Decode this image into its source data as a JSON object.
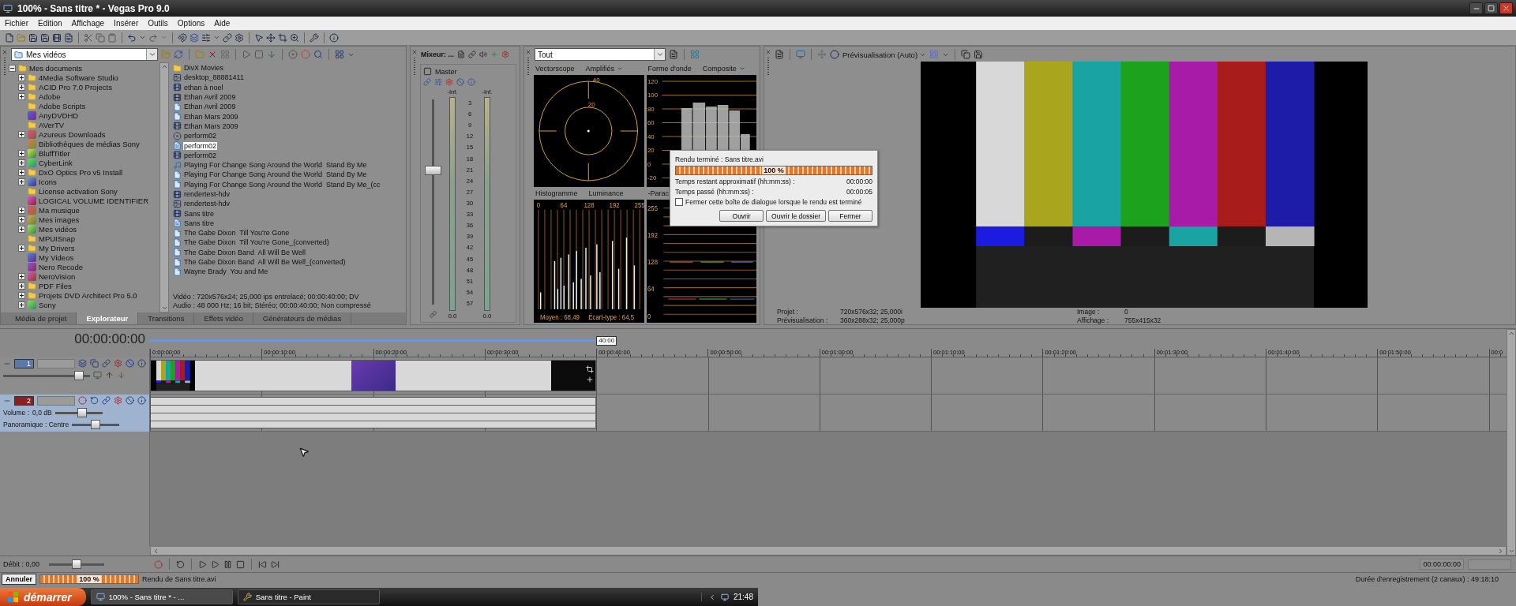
{
  "window": {
    "title": "100% - Sans titre * - Vegas Pro 9.0"
  },
  "menu": [
    "Fichier",
    "Edition",
    "Affichage",
    "Insérer",
    "Outils",
    "Options",
    "Aide"
  ],
  "explorer": {
    "location": "Mes vidéos",
    "tree": {
      "label": "Mes documents",
      "kind": "folder",
      "expanded": true,
      "children": [
        {
          "label": "4Media Software Studio",
          "kind": "folder",
          "expandable": true
        },
        {
          "label": "ACID Pro 7.0 Projects",
          "kind": "folder",
          "expandable": true
        },
        {
          "label": "Adobe",
          "kind": "folder",
          "expandable": true
        },
        {
          "label": "Adobe Scripts",
          "kind": "folder",
          "expandable": false
        },
        {
          "label": "AnyDVDHD",
          "kind": "app",
          "expandable": false
        },
        {
          "label": "AVerTV",
          "kind": "folder",
          "expandable": false
        },
        {
          "label": "Azureus Downloads",
          "kind": "app",
          "expandable": true
        },
        {
          "label": "Bibliothèques de médias Sony",
          "kind": "app",
          "expandable": false
        },
        {
          "label": "BluffTitler",
          "kind": "app",
          "expandable": true
        },
        {
          "label": "CyberLink",
          "kind": "app",
          "expandable": true
        },
        {
          "label": "DxO Optics Pro v5 Install",
          "kind": "folder",
          "expandable": true
        },
        {
          "label": "Icons",
          "kind": "app",
          "expandable": true
        },
        {
          "label": "License activation Sony",
          "kind": "folder",
          "expandable": false
        },
        {
          "label": "LOGICAL VOLUME IDENTIFIER",
          "kind": "app",
          "expandable": false
        },
        {
          "label": "Ma musique",
          "kind": "app",
          "expandable": true
        },
        {
          "label": "Mes images",
          "kind": "app",
          "expandable": true
        },
        {
          "label": "Mes vidéos",
          "kind": "app",
          "expandable": true
        },
        {
          "label": "MPUISnap",
          "kind": "folder",
          "expandable": false
        },
        {
          "label": "My Drivers",
          "kind": "folder",
          "expandable": true
        },
        {
          "label": "My Videos",
          "kind": "app",
          "expandable": false
        },
        {
          "label": "Nero Recode",
          "kind": "app",
          "expandable": false
        },
        {
          "label": "NeroVision",
          "kind": "app",
          "expandable": true
        },
        {
          "label": "PDF Files",
          "kind": "folder",
          "expandable": true
        },
        {
          "label": "Projets DVD Architect Pro 5.0",
          "kind": "folder",
          "expandable": true
        },
        {
          "label": "Sony",
          "kind": "app",
          "expandable": true
        }
      ]
    },
    "files": [
      {
        "name": "DivX Movies",
        "kind": "folder",
        "selected": false
      },
      {
        "name": "desktop_88881411",
        "kind": "image",
        "selected": false
      },
      {
        "name": "ethan à noel",
        "kind": "video",
        "selected": false
      },
      {
        "name": "Ethan Avril 2009",
        "kind": "video",
        "selected": false
      },
      {
        "name": "Ethan Avril 2009",
        "kind": "media",
        "selected": false
      },
      {
        "name": "Ethan Mars 2009",
        "kind": "media",
        "selected": false
      },
      {
        "name": "Ethan Mars 2009",
        "kind": "video",
        "selected": false
      },
      {
        "name": "perform02",
        "kind": "disc",
        "selected": false
      },
      {
        "name": "perform02",
        "kind": "project",
        "selected": true
      },
      {
        "name": "perform02",
        "kind": "video",
        "selected": false
      },
      {
        "name": "Playing For Change Song Around the World  Stand By Me",
        "kind": "audio",
        "selected": false
      },
      {
        "name": "Playing For Change Song Around the World  Stand By Me",
        "kind": "media",
        "selected": false
      },
      {
        "name": "Playing For Change Song Around the World  Stand By Me_(cc",
        "kind": "media",
        "selected": false
      },
      {
        "name": "rendertest-hdv",
        "kind": "video",
        "selected": false
      },
      {
        "name": "rendertest-hdv",
        "kind": "image",
        "selected": false
      },
      {
        "name": "Sans titre",
        "kind": "video",
        "selected": false
      },
      {
        "name": "Sans titre",
        "kind": "project",
        "selected": false
      },
      {
        "name": "The Gabe Dixon  Till You're Gone",
        "kind": "media",
        "selected": false
      },
      {
        "name": "The Gabe Dixon  Till You're Gone_(converted)",
        "kind": "media",
        "selected": false
      },
      {
        "name": "The Gabe Dixon Band  All Will Be Well",
        "kind": "media",
        "selected": false
      },
      {
        "name": "The Gabe Dixon Band  All Will Be Well_(converted)",
        "kind": "media",
        "selected": false
      },
      {
        "name": "Wayne Brady  You and Me",
        "kind": "media",
        "selected": false
      }
    ],
    "info": [
      "Vidéo : 720x576x24; 25,000 ips entrelacé; 00:00:40:00; DV",
      "Audio : 48 000 Hz; 16 bit; Stéréo; 00:00:40:00; Non compressé"
    ]
  },
  "dock_tabs": [
    {
      "label": "Média de projet",
      "selected": false
    },
    {
      "label": "Explorateur",
      "selected": true
    },
    {
      "label": "Transitions",
      "selected": false
    },
    {
      "label": "Effets vidéo",
      "selected": false
    },
    {
      "label": "Générateurs de médias",
      "selected": false
    }
  ],
  "mixer": {
    "title": "Mixeur: ...",
    "channel": "Master",
    "peaks": [
      "-Inf.",
      "-Inf."
    ],
    "scale": [
      "3",
      "6",
      "9",
      "12",
      "15",
      "18",
      "21",
      "24",
      "27",
      "30",
      "33",
      "36",
      "39",
      "42",
      "45",
      "48",
      "51",
      "54",
      "57"
    ],
    "readings": [
      "0.0",
      "0.0"
    ],
    "level": 0.66
  },
  "scopes": {
    "filter": "Tout",
    "panels": [
      {
        "kind": "vectorscope",
        "title": "Vectorscope",
        "mode": "Amplifiés",
        "labels": [
          "40",
          "20"
        ]
      },
      {
        "kind": "waveform",
        "title": "Forme d'onde",
        "mode": "Composite",
        "labels": [
          "120",
          "100",
          "80",
          "60",
          "40",
          "20",
          "0",
          "-20"
        ]
      },
      {
        "kind": "histogram",
        "title": "Histogramme",
        "mode": "Luminance",
        "labels": [
          "0",
          "64",
          "128",
          "192",
          "255"
        ],
        "stats": [
          "Moyen : 68,49",
          "Écart-type : 64,5"
        ]
      },
      {
        "kind": "parade",
        "title": "-Parac",
        "labels": [
          "255",
          "192",
          "128",
          "64",
          "0"
        ]
      }
    ]
  },
  "dialog": {
    "title": "Rendu terminé : Sans titre.avi",
    "level": 1,
    "percent": "100 %",
    "rows": [
      {
        "label": "Temps restant approximatif (hh:mm:ss) :",
        "value": "00:00:00"
      },
      {
        "label": "Temps passé (hh:mm:ss) :",
        "value": "00:00:05"
      }
    ],
    "checkbox": {
      "label": "Fermer cette boîte de dialogue lorsque le rendu est terminé",
      "checked": false
    },
    "buttons": [
      "Ouvrir",
      "Ouvrir le dossier",
      "Fermer"
    ]
  },
  "preview": {
    "mode": "Prévisualisation (Auto)",
    "info": [
      {
        "label": "Projet :",
        "value": "720x576x32; 25,000i"
      },
      {
        "label": "Prévisualisation :",
        "value": "360x288x32; 25,000p"
      },
      {
        "label": "Image :",
        "value": "0"
      },
      {
        "label": "Affichage :",
        "value": "755x415x32"
      }
    ]
  },
  "timeline": {
    "time": "00:00:00:00",
    "loop_end": "40:00",
    "ruler": [
      "0:00:00:00",
      "00:00:10:00",
      "00:00:20:00",
      "00:00:30:00",
      "00:00:40:00",
      "00:00:50:00",
      "00:01:00:00",
      "00:01:10:00",
      "00:01:20:00",
      "00:01:30:00",
      "00:01:40:00",
      "00:01:50:00",
      "00:0"
    ],
    "tracks": [
      {
        "kind": "video",
        "number": "1",
        "selected": false,
        "slider": {
          "level": 0.92
        }
      },
      {
        "kind": "audio",
        "number": "2",
        "selected": true,
        "volume": {
          "label": "Volume :",
          "reading": "0,0 dB",
          "level": 0.6
        },
        "pan": {
          "label": "Panoramique : Centre",
          "level": 0.5
        }
      }
    ]
  },
  "transport": {
    "rate": {
      "label": "Débit : 0,00",
      "level": 0.5
    },
    "time": "00:00:00:00"
  },
  "render": {
    "cancel": "Annuler",
    "level": 1,
    "percent": "100 %",
    "status": "Rendu de Sans titre.avi",
    "record_time": "Durée d'enregistrement (2 canaux) : 49:18:10"
  },
  "taskbar": {
    "start": "démarrer",
    "tasks": [
      {
        "label": "100% - Sans titre * - ...",
        "kind": "vegas",
        "selected": true
      },
      {
        "label": "Sans titre - Paint",
        "kind": "paint",
        "selected": false
      }
    ],
    "clock": "21:48"
  }
}
